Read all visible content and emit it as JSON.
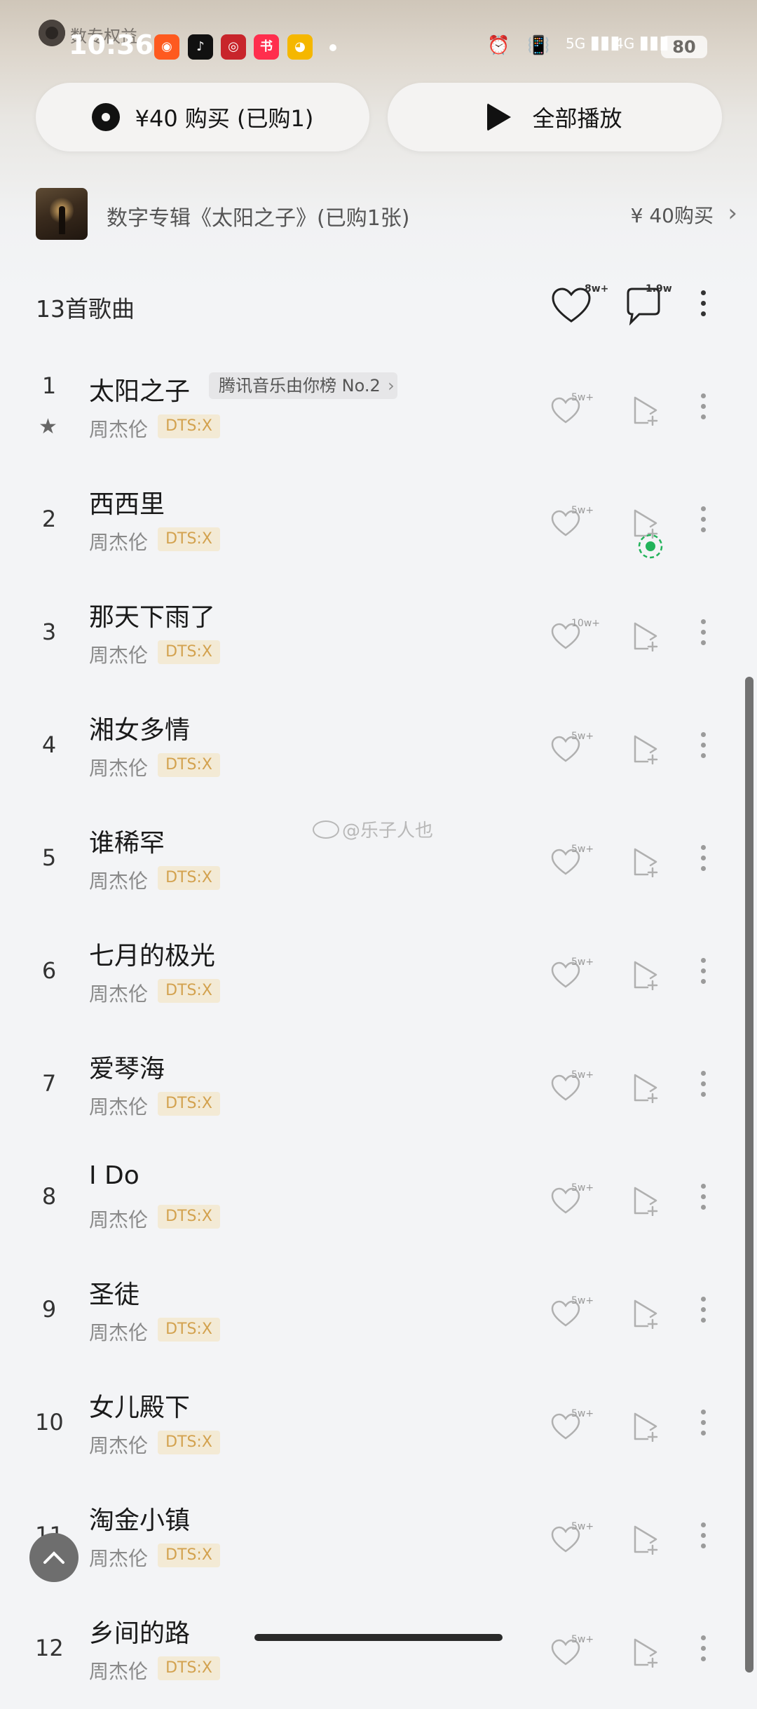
{
  "overlay": {
    "text": "数专权益"
  },
  "status_bar": {
    "time": "10:36",
    "notification_apps": [
      {
        "name": "kuaishou-icon",
        "color": "#fe5a1f",
        "glyph": "◉"
      },
      {
        "name": "tiktok-icon",
        "color": "#111111",
        "glyph": "♪"
      },
      {
        "name": "bank-icon",
        "color": "#c8252b",
        "glyph": "◎"
      },
      {
        "name": "xiaohongshu-icon",
        "color": "#ff2e4d",
        "glyph": "书"
      },
      {
        "name": "weibo-icon",
        "color": "#f5b700",
        "glyph": "◕"
      }
    ],
    "signal_5g": "5G",
    "signal_4g": "4G",
    "battery": "80"
  },
  "actions": {
    "buy_label": "¥40 购买 (已购1)",
    "play_all_label": "全部播放"
  },
  "album": {
    "title": "数字专辑《太阳之子》(已购1张)",
    "price_label": "¥ 40购买"
  },
  "list_header": {
    "count_label": "13首歌曲",
    "likes": "8w+",
    "comments": "1.9w"
  },
  "songs": [
    {
      "index": "1",
      "title": "太阳之子",
      "artist": "周杰伦",
      "quality": "DTS:X",
      "likes": "5w+",
      "chart_badge": "腾讯音乐由你榜 No.2",
      "starred": true
    },
    {
      "index": "2",
      "title": "西西里",
      "artist": "周杰伦",
      "quality": "DTS:X",
      "likes": "5w+",
      "playing": true
    },
    {
      "index": "3",
      "title": "那天下雨了",
      "artist": "周杰伦",
      "quality": "DTS:X",
      "likes": "10w+"
    },
    {
      "index": "4",
      "title": "湘女多情",
      "artist": "周杰伦",
      "quality": "DTS:X",
      "likes": "5w+"
    },
    {
      "index": "5",
      "title": "谁稀罕",
      "artist": "周杰伦",
      "quality": "DTS:X",
      "likes": "5w+"
    },
    {
      "index": "6",
      "title": "七月的极光",
      "artist": "周杰伦",
      "quality": "DTS:X",
      "likes": "5w+"
    },
    {
      "index": "7",
      "title": "爱琴海",
      "artist": "周杰伦",
      "quality": "DTS:X",
      "likes": "5w+"
    },
    {
      "index": "8",
      "title": "I Do",
      "artist": "周杰伦",
      "quality": "DTS:X",
      "likes": "5w+"
    },
    {
      "index": "9",
      "title": "圣徒",
      "artist": "周杰伦",
      "quality": "DTS:X",
      "likes": "5w+"
    },
    {
      "index": "10",
      "title": "女儿殿下",
      "artist": "周杰伦",
      "quality": "DTS:X",
      "likes": "5w+"
    },
    {
      "index": "11",
      "title": "淘金小镇",
      "artist": "周杰伦",
      "quality": "DTS:X",
      "likes": "5w+"
    },
    {
      "index": "12",
      "title": "乡间的路",
      "artist": "周杰伦",
      "quality": "DTS:X",
      "likes": "5w+"
    }
  ],
  "watermark": "@乐子人也",
  "colors": {
    "accent_green": "#22b35a",
    "dts_gold": "#d3a24f"
  }
}
